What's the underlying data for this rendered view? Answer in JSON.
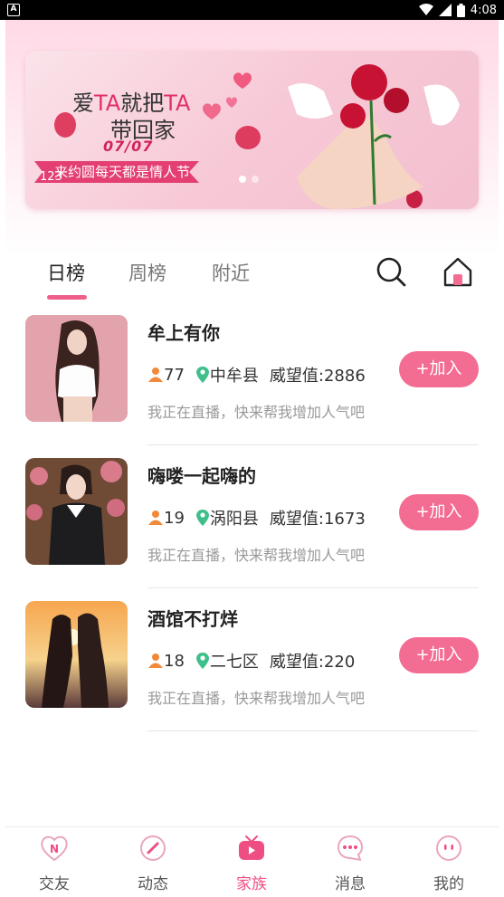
{
  "status_bar": {
    "badge": "A",
    "time": "4:08"
  },
  "banner": {
    "line1_a": "爱",
    "line1_b": "TA",
    "line1_c": "就把",
    "line1_d": "TA",
    "line2": "带回家",
    "date": "07/07",
    "ribbon": "来约圆每天都是情人节",
    "counter": "123"
  },
  "tabs": [
    {
      "label": "日榜",
      "active": true
    },
    {
      "label": "周榜",
      "active": false
    },
    {
      "label": "附近",
      "active": false
    }
  ],
  "rooms": [
    {
      "title": "牟上有你",
      "members": "77",
      "location": "中牟县",
      "prestige": "威望值:2886",
      "desc": "我正在直播，快来帮我增加人气吧",
      "join": "+加入"
    },
    {
      "title": "嗨喽一起嗨的",
      "members": "19",
      "location": "涡阳县",
      "prestige": "威望值:1673",
      "desc": "我正在直播，快来帮我增加人气吧",
      "join": "+加入"
    },
    {
      "title": "酒馆不打烊",
      "members": "18",
      "location": "二七区",
      "prestige": "威望值:220",
      "desc": "我正在直播，快来帮我增加人气吧",
      "join": "+加入"
    }
  ],
  "bottom_nav": [
    {
      "label": "交友",
      "icon": "heart-n-icon"
    },
    {
      "label": "动态",
      "icon": "compass-icon"
    },
    {
      "label": "家族",
      "icon": "tv-icon",
      "active": true
    },
    {
      "label": "消息",
      "icon": "chat-bubble-icon"
    },
    {
      "label": "我的",
      "icon": "face-icon"
    }
  ],
  "colors": {
    "accent": "#ef4e82",
    "join_button": "#f36c91",
    "banner_pink": "#e33f72"
  }
}
